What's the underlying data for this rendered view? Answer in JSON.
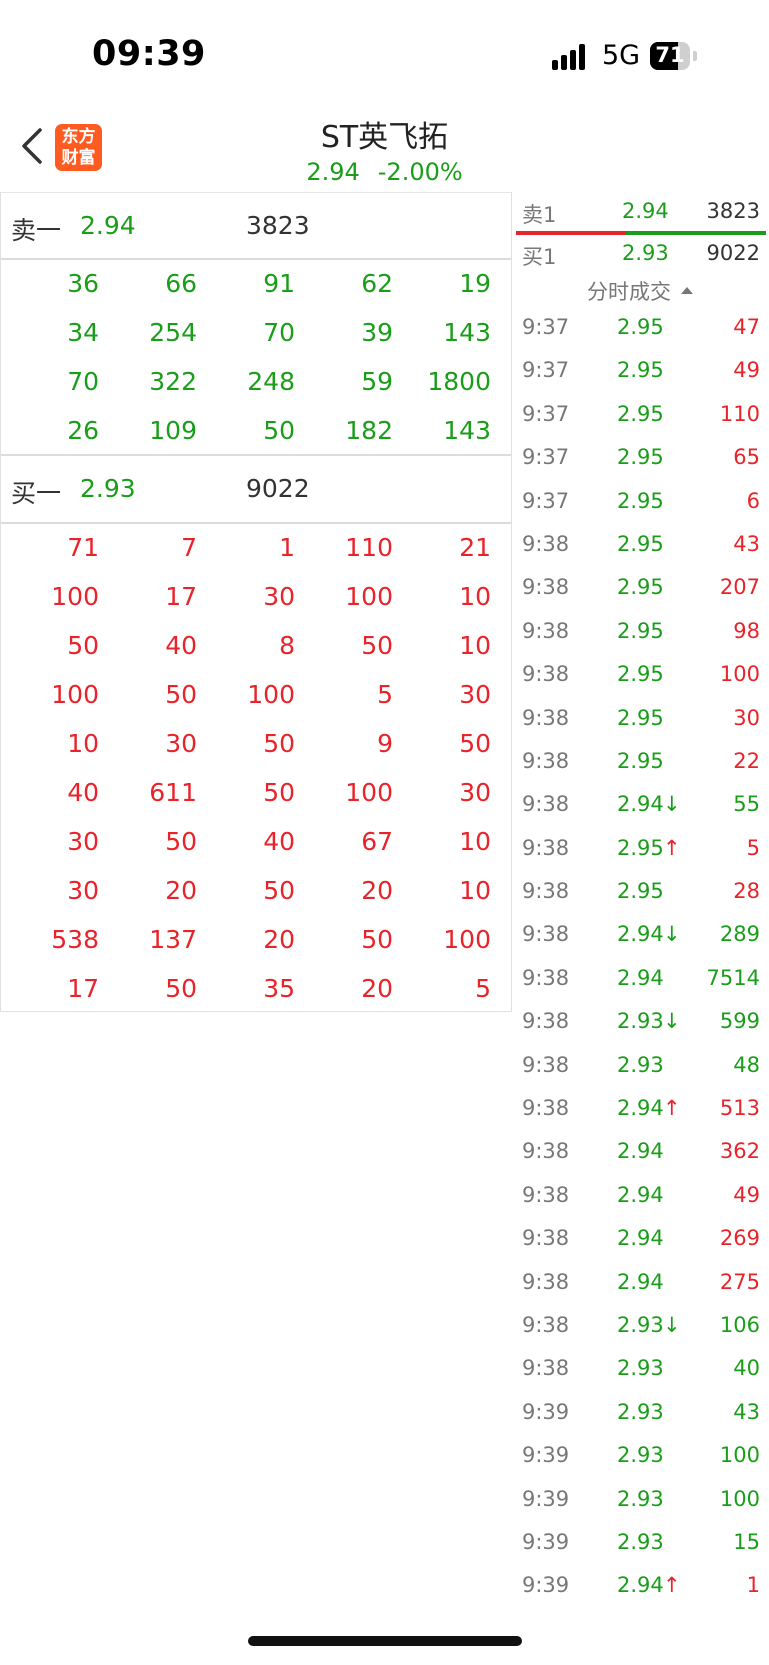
{
  "status": {
    "time": "09:39",
    "network": "5G",
    "battery": "71"
  },
  "header": {
    "logo_line1": "东方",
    "logo_line2": "财富",
    "title": "ST英飞拓",
    "price": "2.94",
    "change_pct": "-2.00%"
  },
  "colors": {
    "up": "#e8232a",
    "down": "#1a9e1a",
    "logo": "#ff5a1f"
  },
  "queue": {
    "sell": {
      "label": "卖一",
      "price": "2.94",
      "volume": "3823",
      "orders": [
        [
          "36",
          "66",
          "91",
          "62",
          "19"
        ],
        [
          "34",
          "254",
          "70",
          "39",
          "143"
        ],
        [
          "70",
          "322",
          "248",
          "59",
          "1800"
        ],
        [
          "26",
          "109",
          "50",
          "182",
          "143"
        ]
      ]
    },
    "buy": {
      "label": "买一",
      "price": "2.93",
      "volume": "9022",
      "orders": [
        [
          "71",
          "7",
          "1",
          "110",
          "21"
        ],
        [
          "100",
          "17",
          "30",
          "100",
          "10"
        ],
        [
          "50",
          "40",
          "8",
          "50",
          "10"
        ],
        [
          "100",
          "50",
          "100",
          "5",
          "30"
        ],
        [
          "10",
          "30",
          "50",
          "9",
          "50"
        ],
        [
          "40",
          "611",
          "50",
          "100",
          "30"
        ],
        [
          "30",
          "50",
          "40",
          "67",
          "10"
        ],
        [
          "30",
          "20",
          "50",
          "20",
          "10"
        ],
        [
          "538",
          "137",
          "20",
          "50",
          "100"
        ],
        [
          "17",
          "50",
          "35",
          "20",
          "5"
        ]
      ]
    }
  },
  "orderbook": {
    "sell1": {
      "label": "卖1",
      "price": "2.94",
      "volume": "3823"
    },
    "buy1": {
      "label": "买1",
      "price": "2.93",
      "volume": "9022"
    },
    "buy_ratio": 0.44
  },
  "ticks_header": "分时成交",
  "ticks": [
    {
      "time": "9:37",
      "price": "2.95",
      "arrow": "",
      "volume": "47",
      "side": "up"
    },
    {
      "time": "9:37",
      "price": "2.95",
      "arrow": "",
      "volume": "49",
      "side": "up"
    },
    {
      "time": "9:37",
      "price": "2.95",
      "arrow": "",
      "volume": "110",
      "side": "up"
    },
    {
      "time": "9:37",
      "price": "2.95",
      "arrow": "",
      "volume": "65",
      "side": "up"
    },
    {
      "time": "9:37",
      "price": "2.95",
      "arrow": "",
      "volume": "6",
      "side": "up"
    },
    {
      "time": "9:38",
      "price": "2.95",
      "arrow": "",
      "volume": "43",
      "side": "up"
    },
    {
      "time": "9:38",
      "price": "2.95",
      "arrow": "",
      "volume": "207",
      "side": "up"
    },
    {
      "time": "9:38",
      "price": "2.95",
      "arrow": "",
      "volume": "98",
      "side": "up"
    },
    {
      "time": "9:38",
      "price": "2.95",
      "arrow": "",
      "volume": "100",
      "side": "up"
    },
    {
      "time": "9:38",
      "price": "2.95",
      "arrow": "",
      "volume": "30",
      "side": "up"
    },
    {
      "time": "9:38",
      "price": "2.95",
      "arrow": "",
      "volume": "22",
      "side": "up"
    },
    {
      "time": "9:38",
      "price": "2.94",
      "arrow": "↓",
      "volume": "55",
      "side": "down"
    },
    {
      "time": "9:38",
      "price": "2.95",
      "arrow": "↑",
      "volume": "5",
      "side": "up"
    },
    {
      "time": "9:38",
      "price": "2.95",
      "arrow": "",
      "volume": "28",
      "side": "up"
    },
    {
      "time": "9:38",
      "price": "2.94",
      "arrow": "↓",
      "volume": "289",
      "side": "down"
    },
    {
      "time": "9:38",
      "price": "2.94",
      "arrow": "",
      "volume": "7514",
      "side": "down"
    },
    {
      "time": "9:38",
      "price": "2.93",
      "arrow": "↓",
      "volume": "599",
      "side": "down"
    },
    {
      "time": "9:38",
      "price": "2.93",
      "arrow": "",
      "volume": "48",
      "side": "down"
    },
    {
      "time": "9:38",
      "price": "2.94",
      "arrow": "↑",
      "volume": "513",
      "side": "up"
    },
    {
      "time": "9:38",
      "price": "2.94",
      "arrow": "",
      "volume": "362",
      "side": "up"
    },
    {
      "time": "9:38",
      "price": "2.94",
      "arrow": "",
      "volume": "49",
      "side": "up"
    },
    {
      "time": "9:38",
      "price": "2.94",
      "arrow": "",
      "volume": "269",
      "side": "up"
    },
    {
      "time": "9:38",
      "price": "2.94",
      "arrow": "",
      "volume": "275",
      "side": "up"
    },
    {
      "time": "9:38",
      "price": "2.93",
      "arrow": "↓",
      "volume": "106",
      "side": "down"
    },
    {
      "time": "9:38",
      "price": "2.93",
      "arrow": "",
      "volume": "40",
      "side": "down"
    },
    {
      "time": "9:39",
      "price": "2.93",
      "arrow": "",
      "volume": "43",
      "side": "down"
    },
    {
      "time": "9:39",
      "price": "2.93",
      "arrow": "",
      "volume": "100",
      "side": "down"
    },
    {
      "time": "9:39",
      "price": "2.93",
      "arrow": "",
      "volume": "100",
      "side": "down"
    },
    {
      "time": "9:39",
      "price": "2.93",
      "arrow": "",
      "volume": "15",
      "side": "down"
    },
    {
      "time": "9:39",
      "price": "2.94",
      "arrow": "↑",
      "volume": "1",
      "side": "up"
    }
  ]
}
